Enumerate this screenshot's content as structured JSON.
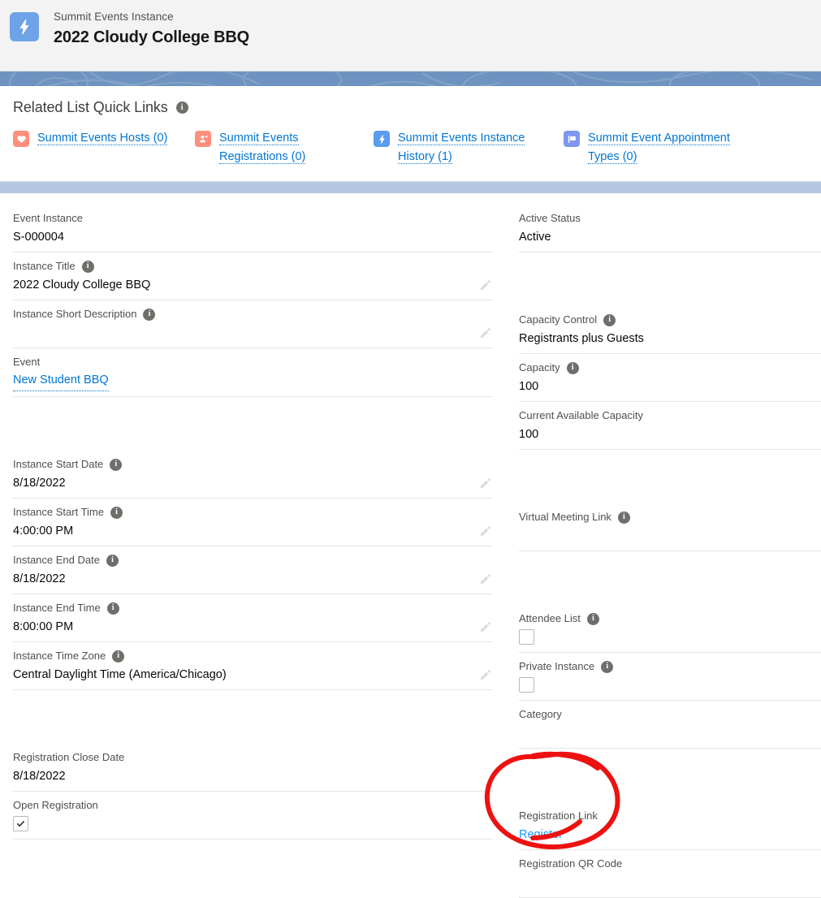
{
  "header": {
    "icon": "lightning-bolt-icon",
    "eyebrow": "Summit Events Instance",
    "title": "2022 Cloudy College BBQ",
    "icon_color": "#6fa3e8"
  },
  "quick_links": {
    "title": "Related List Quick Links",
    "info_glyph": "i",
    "items": [
      {
        "icon": "heart-icon",
        "icon_color": "#fe8f7d",
        "label": "Summit Events Hosts (0)"
      },
      {
        "icon": "person-add-icon",
        "icon_color": "#fe8f7d",
        "label": "Summit Events Registrations (0)"
      },
      {
        "icon": "lightning-bolt-icon",
        "icon_color": "#5a9cf0",
        "label": "Summit Events Instance History (1)"
      },
      {
        "icon": "flag-icon",
        "icon_color": "#7f97f0",
        "label": "Summit Event Appointment Types (0)"
      }
    ]
  },
  "details": {
    "left_column": [
      {
        "label": "Event Instance",
        "value": "S-000004",
        "has_info": false,
        "editable": false,
        "type": "text"
      },
      {
        "label": "Instance Title",
        "value": "2022 Cloudy College BBQ",
        "has_info": true,
        "editable": true,
        "type": "text"
      },
      {
        "label": "Instance Short Description",
        "value": "",
        "has_info": true,
        "editable": true,
        "type": "text"
      },
      {
        "label": "Event",
        "value": "New Student BBQ",
        "has_info": false,
        "editable": false,
        "type": "link"
      },
      {
        "label": "",
        "value": "",
        "has_info": false,
        "editable": false,
        "type": "spacer"
      },
      {
        "label": "Instance Start Date",
        "value": "8/18/2022",
        "has_info": true,
        "editable": true,
        "type": "text"
      },
      {
        "label": "Instance Start Time",
        "value": "4:00:00 PM",
        "has_info": true,
        "editable": true,
        "type": "text"
      },
      {
        "label": "Instance End Date",
        "value": "8/18/2022",
        "has_info": true,
        "editable": true,
        "type": "text"
      },
      {
        "label": "Instance End Time",
        "value": "8:00:00 PM",
        "has_info": true,
        "editable": true,
        "type": "text"
      },
      {
        "label": "Instance Time Zone",
        "value": "Central Daylight Time (America/Chicago)",
        "has_info": true,
        "editable": true,
        "type": "text"
      },
      {
        "label": "",
        "value": "",
        "has_info": false,
        "editable": false,
        "type": "spacer"
      },
      {
        "label": "Registration Close Date",
        "value": "8/18/2022",
        "has_info": false,
        "editable": false,
        "type": "text"
      },
      {
        "label": "Open Registration",
        "value": "",
        "has_info": false,
        "editable": false,
        "type": "checkbox",
        "checked": true
      }
    ],
    "right_column": [
      {
        "label": "Active Status",
        "value": "Active",
        "has_info": false,
        "editable": false,
        "type": "text"
      },
      {
        "label": "",
        "value": "",
        "has_info": false,
        "editable": false,
        "type": "spacer"
      },
      {
        "label": "Capacity Control",
        "value": "Registrants plus Guests",
        "has_info": true,
        "editable": false,
        "type": "text"
      },
      {
        "label": "Capacity",
        "value": "100",
        "has_info": true,
        "editable": false,
        "type": "text"
      },
      {
        "label": "Current Available Capacity",
        "value": "100",
        "has_info": false,
        "editable": false,
        "type": "text"
      },
      {
        "label": "",
        "value": "",
        "has_info": false,
        "editable": false,
        "type": "spacer"
      },
      {
        "label": "Virtual Meeting Link",
        "value": "",
        "has_info": true,
        "editable": false,
        "type": "text"
      },
      {
        "label": "",
        "value": "",
        "has_info": false,
        "editable": false,
        "type": "spacer"
      },
      {
        "label": "Attendee List",
        "value": "",
        "has_info": true,
        "editable": false,
        "type": "checkbox",
        "checked": false
      },
      {
        "label": "Private Instance",
        "value": "",
        "has_info": true,
        "editable": false,
        "type": "checkbox",
        "checked": false
      },
      {
        "label": "Category",
        "value": "",
        "has_info": false,
        "editable": false,
        "type": "text"
      },
      {
        "label": "",
        "value": "",
        "has_info": false,
        "editable": false,
        "type": "spacer"
      },
      {
        "label": "Registration Link",
        "value": "Register",
        "has_info": false,
        "editable": false,
        "type": "plainlink"
      },
      {
        "label": "Registration QR Code",
        "value": "",
        "has_info": false,
        "editable": false,
        "type": "text"
      }
    ]
  },
  "annotation": {
    "shape": "hand-drawn-circle",
    "color": "#ee1111",
    "target": "Registration Link / Register"
  },
  "colors": {
    "link": "#0176d3",
    "banner": "#6f93c0",
    "divider_band": "#b5c7e3",
    "header_bg": "#f3f3f3"
  }
}
